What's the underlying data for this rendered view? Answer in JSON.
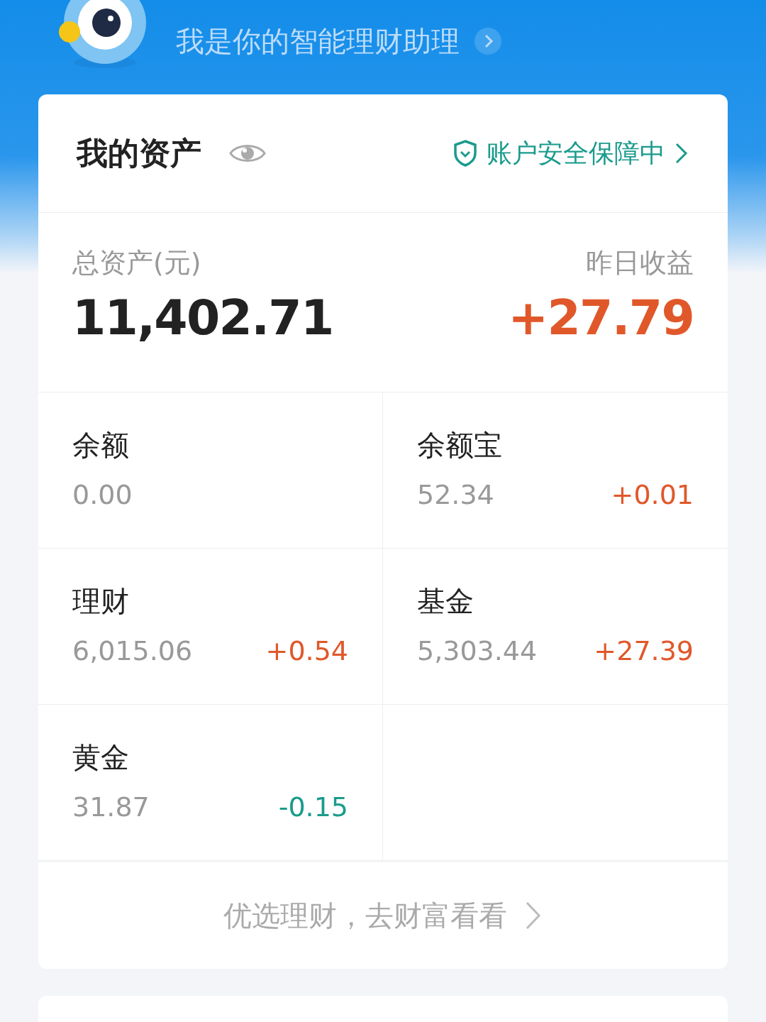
{
  "assistant": {
    "subtitle": "我是你的智能理财助理"
  },
  "assets": {
    "title": "我的资产",
    "security": "账户安全保障中",
    "total_label": "总资产(元)",
    "total_value": "11,402.71",
    "yesterday": {
      "label": "昨日收益",
      "value": "+27.79",
      "color": "#e0582a"
    },
    "items": [
      {
        "label": "余额",
        "value": "0.00"
      },
      {
        "label": "余额宝",
        "value": "52.34",
        "change": "+0.01",
        "color": "#e0582a"
      },
      {
        "label": "理财",
        "value": "6,015.06",
        "change": "+0.54",
        "color": "#e0582a"
      },
      {
        "label": "基金",
        "value": "5,303.44",
        "change": "+27.39",
        "color": "#e0582a"
      },
      {
        "label": "黄金",
        "value": "31.87",
        "change": "-0.15",
        "color": "#1a9b8c"
      }
    ],
    "promo": "优选理财，去财富看看"
  }
}
